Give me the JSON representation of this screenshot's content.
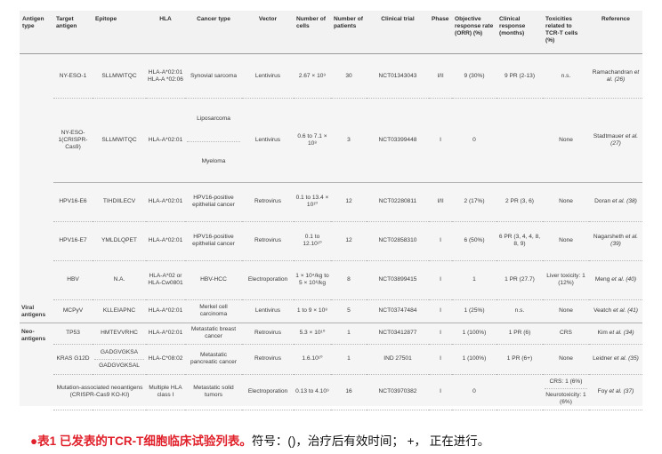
{
  "headers": [
    "Antigen type",
    "Target antigen",
    "Epitope",
    "HLA",
    "Cancer type",
    "Vector",
    "Number of cells",
    "Number of patients",
    "Clinical trial",
    "Phase",
    "Objective response rate (ORR) (%)",
    "Clinical response (months)",
    "Toxicities related to TCR-T cells (%)",
    "Reference"
  ],
  "group_labels": {
    "viral": "Viral antigens",
    "neo": "Neo-antigens"
  },
  "rows": [
    {
      "target": "NY-ESO-1",
      "epitope": "SLLMWITQC",
      "hla": "HLA-A*02:01 HLA-A *02:06",
      "cancer": "Synovial sarcoma",
      "vector": "Lentivirus",
      "cells": "2.67 × 10⁹",
      "patients": "30",
      "trial": "NCT01343043",
      "phase": "I/II",
      "orr": "9 (30%)",
      "response": "9 PR (2-13)",
      "tox": "n.s.",
      "ref_name": "Ramachandran",
      "ref_cite": "et al. (26)"
    },
    {
      "target": "NY-ESO-1(CRISPR-Cas9)",
      "epitope": "SLLMWITQC",
      "hla": "HLA-A*02:01",
      "cancer_a": "Liposarcoma",
      "cancer_b": "Myeloma",
      "vector": "Lentivirus",
      "cells": "0.6 to 7.1 × 10⁸",
      "patients": "3",
      "trial": "NCT03399448",
      "phase": "I",
      "orr": "0",
      "response": "",
      "tox": "None",
      "ref_name": "Stadtmauer",
      "ref_cite": "et al. (27)"
    },
    {
      "target": "HPV16-E6",
      "epitope": "TIHDIILECV",
      "hla": "HLA-A*02:01",
      "cancer": "HPV16-positive epithelial cancer",
      "vector": "Retrovirus",
      "cells": "0.1 to 13.4 × 10¹⁰",
      "patients": "12",
      "trial": "NCT02280811",
      "phase": "I/II",
      "orr": "2 (17%)",
      "response": "2 PR (3, 6)",
      "tox": "None",
      "ref_name": "Doran",
      "ref_cite": "et al. (38)"
    },
    {
      "target": "HPV16-E7",
      "epitope": "YMLDLQPET",
      "hla": "HLA-A*02:01",
      "cancer": "HPV16-positive epithelial cancer",
      "vector": "Retrovirus",
      "cells": "0.1 to 12.10¹⁰",
      "patients": "12",
      "trial": "NCT02858310",
      "phase": "I",
      "orr": "6 (50%)",
      "response": "6 PR (3, 4, 4, 8, 8, 9)",
      "tox": "None",
      "ref_name": "Nagarsheth",
      "ref_cite": "et al. (39)"
    },
    {
      "target": "HBV",
      "epitope": "N.A.",
      "hla": "HLA-A*02 or HLA-Cw0801",
      "cancer": "HBV-HCC",
      "vector": "Electroporation",
      "cells": "1 × 10⁴/kg to 5 × 10⁶/kg",
      "patients": "8",
      "trial": "NCT03899415",
      "phase": "I",
      "orr": "1",
      "response": "1 PR (27.7)",
      "tox": "Liver toxicity: 1 (12%)",
      "ref_name": "Meng",
      "ref_cite": "et al. (40)"
    },
    {
      "target": "MCPyV",
      "epitope": "KLLEIAPNC",
      "hla": "HLA-A*02:01",
      "cancer": "Merkel cell carcinoma",
      "vector": "Lentivirus",
      "cells": "1 to 9 × 10⁸",
      "patients": "5",
      "trial": "NCT03747484",
      "phase": "I",
      "orr": "1 (25%)",
      "response": "n.s.",
      "tox": "None",
      "ref_name": "Veatch",
      "ref_cite": "et al. (41)"
    },
    {
      "target": "TP53",
      "epitope": "HMTEVVRHC",
      "hla": "HLA-A*02:01",
      "cancer": "Metastatic breast cancer",
      "vector": "Retrovirus",
      "cells": "5.3 × 10¹⁰",
      "patients": "1",
      "trial": "NCT03412877",
      "phase": "I",
      "orr": "1 (100%)",
      "response": "1 PR (6)",
      "tox": "CRS",
      "ref_name": "Kim",
      "ref_cite": "et al. (34)"
    },
    {
      "target": "KRAS G12D",
      "epitope_a": "GADGVGKSA",
      "epitope_b": "GADGVGKSAL",
      "hla": "HLA-C*08:02",
      "cancer": "Metastatic pancreatic cancer",
      "vector": "Retrovirus",
      "cells": "1.6.10¹⁰",
      "patients": "1",
      "trial": "IND 27501",
      "phase": "I",
      "orr": "1 (100%)",
      "response": "1 PR (6+)",
      "tox": "None",
      "ref_name": "Leidner",
      "ref_cite": "et al. (35)"
    },
    {
      "target": "Mutation-associated neoantigens (CRISPR-Cas9 KO-KI)",
      "epitope": "",
      "hla": "Multiple HLA class I",
      "cancer": "Metastatic solid tumors",
      "vector": "Electroporation",
      "cells": "0.13 to 4.10⁹",
      "patients": "16",
      "trial": "NCT03970382",
      "phase": "I",
      "orr": "0",
      "response": "",
      "tox_a": "CRS: 1 (6%)",
      "tox_b": "Neurotoxicity: 1 (6%)",
      "ref_name": "Foy",
      "ref_cite": "et al. (37)"
    }
  ],
  "caption": {
    "bullet": "●",
    "lead": "表1 已发表的TCR-T细胞临床试验列表。",
    "rest": "符号：()，治疗后有效时间； +， 正在进行。"
  }
}
